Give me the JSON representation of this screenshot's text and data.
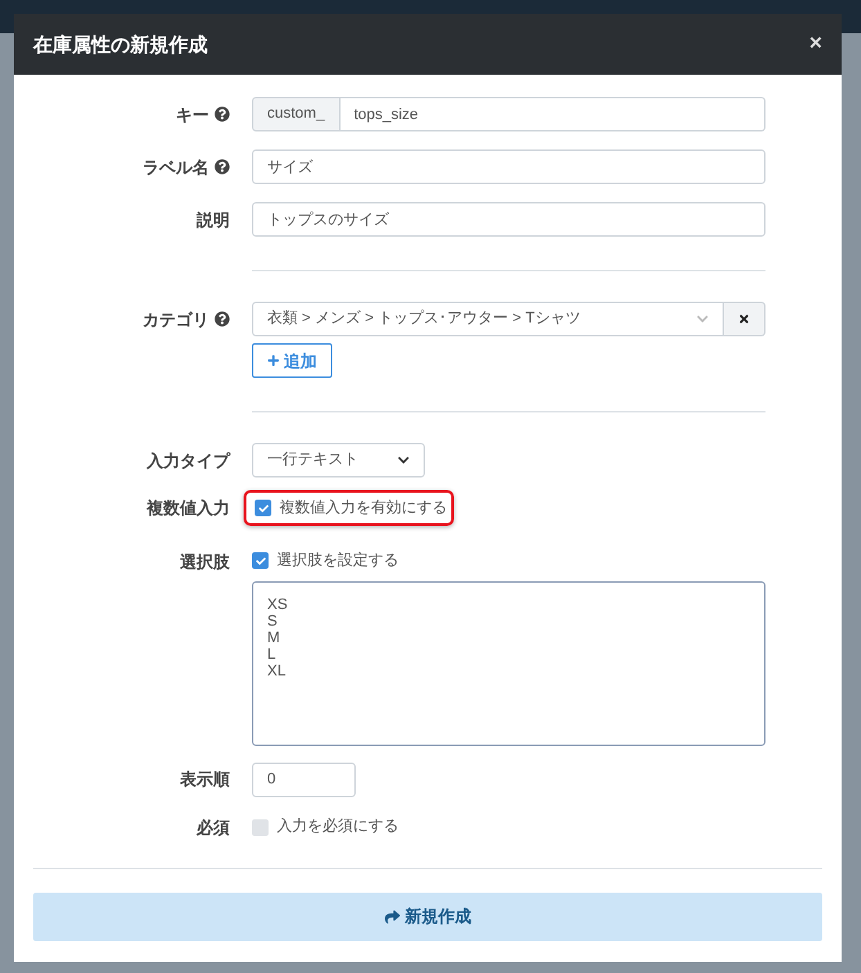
{
  "dialog": {
    "title": "在庫属性の新規作成",
    "close": "×"
  },
  "key": {
    "label": "キー",
    "prefix": "custom_",
    "value": "tops_size"
  },
  "label_name": {
    "label": "ラベル名",
    "value": "サイズ"
  },
  "description": {
    "label": "説明",
    "value": "トップスのサイズ"
  },
  "category": {
    "label": "カテゴリ",
    "value": "衣類 > メンズ > トップス･アウター > Tシャツ",
    "add_button": "追加"
  },
  "input_type": {
    "label": "入力タイプ",
    "value": "一行テキスト"
  },
  "multiple": {
    "label": "複数値入力",
    "option": "複数値入力を有効にする",
    "checked": true,
    "highlighted": true
  },
  "choices": {
    "label": "選択肢",
    "option": "選択肢を設定する",
    "checked": true,
    "lines": [
      "XS",
      "S",
      "M",
      "L",
      "XL"
    ]
  },
  "display_order": {
    "label": "表示順",
    "value": "0"
  },
  "required": {
    "label": "必須",
    "option": "入力を必須にする",
    "checked": false
  },
  "submit": "新規作成"
}
